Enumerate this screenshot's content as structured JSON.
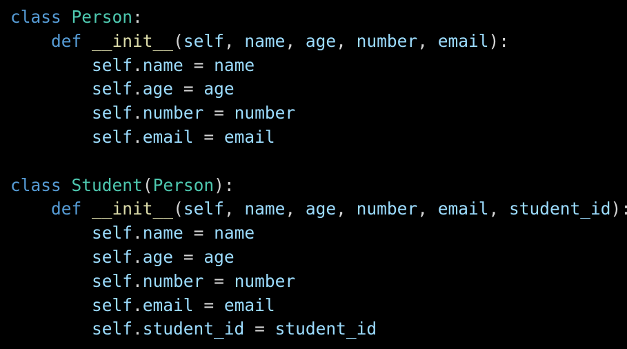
{
  "colors": {
    "background": "#000000",
    "keyword": "#569cd6",
    "class_name": "#4ec9b0",
    "function_name": "#dcdcaa",
    "identifier": "#9cdcfe",
    "punctuation": "#d4d4d4"
  },
  "code": {
    "lines": [
      {
        "indent": "",
        "tokens": [
          {
            "type": "keyword",
            "text": "class"
          },
          {
            "type": "plain",
            "text": " "
          },
          {
            "type": "class",
            "text": "Person"
          },
          {
            "type": "punct",
            "text": ":"
          }
        ]
      },
      {
        "indent": "    ",
        "tokens": [
          {
            "type": "keyword",
            "text": "def"
          },
          {
            "type": "plain",
            "text": " "
          },
          {
            "type": "func",
            "text": "__init__"
          },
          {
            "type": "punct",
            "text": "("
          },
          {
            "type": "param",
            "text": "self"
          },
          {
            "type": "punct",
            "text": ", "
          },
          {
            "type": "param",
            "text": "name"
          },
          {
            "type": "punct",
            "text": ", "
          },
          {
            "type": "param",
            "text": "age"
          },
          {
            "type": "punct",
            "text": ", "
          },
          {
            "type": "param",
            "text": "number"
          },
          {
            "type": "punct",
            "text": ", "
          },
          {
            "type": "param",
            "text": "email"
          },
          {
            "type": "punct",
            "text": "):"
          }
        ]
      },
      {
        "indent": "        ",
        "tokens": [
          {
            "type": "var",
            "text": "self"
          },
          {
            "type": "punct",
            "text": "."
          },
          {
            "type": "var",
            "text": "name"
          },
          {
            "type": "punct",
            "text": " = "
          },
          {
            "type": "var",
            "text": "name"
          }
        ]
      },
      {
        "indent": "        ",
        "tokens": [
          {
            "type": "var",
            "text": "self"
          },
          {
            "type": "punct",
            "text": "."
          },
          {
            "type": "var",
            "text": "age"
          },
          {
            "type": "punct",
            "text": " = "
          },
          {
            "type": "var",
            "text": "age"
          }
        ]
      },
      {
        "indent": "        ",
        "tokens": [
          {
            "type": "var",
            "text": "self"
          },
          {
            "type": "punct",
            "text": "."
          },
          {
            "type": "var",
            "text": "number"
          },
          {
            "type": "punct",
            "text": " = "
          },
          {
            "type": "var",
            "text": "number"
          }
        ]
      },
      {
        "indent": "        ",
        "tokens": [
          {
            "type": "var",
            "text": "self"
          },
          {
            "type": "punct",
            "text": "."
          },
          {
            "type": "var",
            "text": "email"
          },
          {
            "type": "punct",
            "text": " = "
          },
          {
            "type": "var",
            "text": "email"
          }
        ]
      },
      {
        "indent": "",
        "tokens": []
      },
      {
        "indent": "",
        "tokens": [
          {
            "type": "keyword",
            "text": "class"
          },
          {
            "type": "plain",
            "text": " "
          },
          {
            "type": "class",
            "text": "Student"
          },
          {
            "type": "punct",
            "text": "("
          },
          {
            "type": "class",
            "text": "Person"
          },
          {
            "type": "punct",
            "text": "):"
          }
        ]
      },
      {
        "indent": "    ",
        "tokens": [
          {
            "type": "keyword",
            "text": "def"
          },
          {
            "type": "plain",
            "text": " "
          },
          {
            "type": "func",
            "text": "__init__"
          },
          {
            "type": "punct",
            "text": "("
          },
          {
            "type": "param",
            "text": "self"
          },
          {
            "type": "punct",
            "text": ", "
          },
          {
            "type": "param",
            "text": "name"
          },
          {
            "type": "punct",
            "text": ", "
          },
          {
            "type": "param",
            "text": "age"
          },
          {
            "type": "punct",
            "text": ", "
          },
          {
            "type": "param",
            "text": "number"
          },
          {
            "type": "punct",
            "text": ", "
          },
          {
            "type": "param",
            "text": "email"
          },
          {
            "type": "punct",
            "text": ", "
          },
          {
            "type": "param",
            "text": "student_id"
          },
          {
            "type": "punct",
            "text": "):"
          }
        ]
      },
      {
        "indent": "        ",
        "tokens": [
          {
            "type": "var",
            "text": "self"
          },
          {
            "type": "punct",
            "text": "."
          },
          {
            "type": "var",
            "text": "name"
          },
          {
            "type": "punct",
            "text": " = "
          },
          {
            "type": "var",
            "text": "name"
          }
        ]
      },
      {
        "indent": "        ",
        "tokens": [
          {
            "type": "var",
            "text": "self"
          },
          {
            "type": "punct",
            "text": "."
          },
          {
            "type": "var",
            "text": "age"
          },
          {
            "type": "punct",
            "text": " = "
          },
          {
            "type": "var",
            "text": "age"
          }
        ]
      },
      {
        "indent": "        ",
        "tokens": [
          {
            "type": "var",
            "text": "self"
          },
          {
            "type": "punct",
            "text": "."
          },
          {
            "type": "var",
            "text": "number"
          },
          {
            "type": "punct",
            "text": " = "
          },
          {
            "type": "var",
            "text": "number"
          }
        ]
      },
      {
        "indent": "        ",
        "tokens": [
          {
            "type": "var",
            "text": "self"
          },
          {
            "type": "punct",
            "text": "."
          },
          {
            "type": "var",
            "text": "email"
          },
          {
            "type": "punct",
            "text": " = "
          },
          {
            "type": "var",
            "text": "email"
          }
        ]
      },
      {
        "indent": "        ",
        "tokens": [
          {
            "type": "var",
            "text": "self"
          },
          {
            "type": "punct",
            "text": "."
          },
          {
            "type": "var",
            "text": "student_id"
          },
          {
            "type": "punct",
            "text": " = "
          },
          {
            "type": "var",
            "text": "student_id"
          }
        ]
      }
    ]
  }
}
